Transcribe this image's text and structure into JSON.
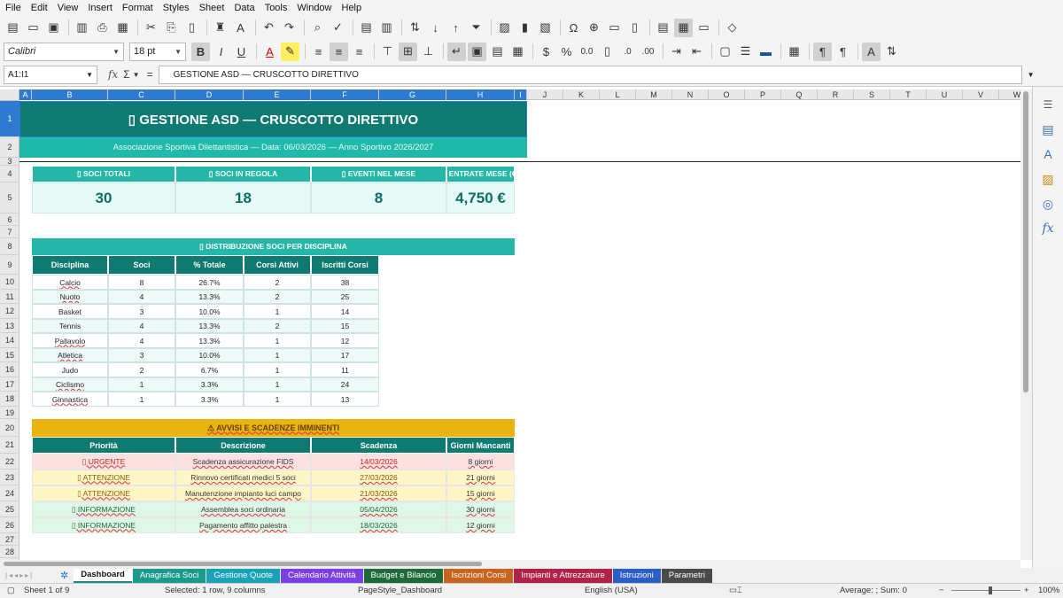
{
  "menu": [
    "File",
    "Edit",
    "View",
    "Insert",
    "Format",
    "Styles",
    "Sheet",
    "Data",
    "Tools",
    "Window",
    "Help"
  ],
  "font": {
    "name": "Calibri",
    "size": "18 pt"
  },
  "formula": {
    "namebox": "A1:I1",
    "content": " GESTIONE ASD — CRUSCOTTO DIRETTIVO",
    "fx": "fx",
    "sigma": "Σ",
    "equals": "="
  },
  "columns": [
    "A",
    "B",
    "C",
    "D",
    "E",
    "F",
    "G",
    "H",
    "I",
    "J",
    "K",
    "L",
    "M",
    "N",
    "O",
    "P",
    "Q",
    "R",
    "S",
    "T",
    "U",
    "V",
    "W"
  ],
  "rows": [
    "1",
    "2",
    "3",
    "4",
    "5",
    "6",
    "7",
    "8",
    "9",
    "10",
    "11",
    "12",
    "13",
    "14",
    "15",
    "16",
    "17",
    "18",
    "19",
    "20",
    "21",
    "22",
    "23",
    "24",
    "25",
    "26",
    "27",
    "28"
  ],
  "sheet": {
    "title": "▯  GESTIONE ASD — CRUSCOTTO DIRETTIVO",
    "subtitle": "Associazione Sportiva Dilettantistica  —  Data: 06/03/2026  —  Anno Sportivo 2026/2027",
    "kpis": [
      {
        "label": "▯ SOCI TOTALI",
        "value": "30"
      },
      {
        "label": "▯ SOCI IN REGOLA",
        "value": "18"
      },
      {
        "label": "▯ EVENTI NEL MESE",
        "value": "8"
      },
      {
        "label": "▯ ENTRATE MESE (€)",
        "value": "4,750 €"
      }
    ],
    "discipline_title": "▯ DISTRIBUZIONE SOCI PER DISCIPLINA",
    "discipline_headers": [
      "Disciplina",
      "Soci",
      "% Totale",
      "Corsi Attivi",
      "Iscritti Corsi"
    ],
    "discipline_rows": [
      [
        "Calcio",
        "8",
        "26.7%",
        "2",
        "38"
      ],
      [
        "Nuoto",
        "4",
        "13.3%",
        "2",
        "25"
      ],
      [
        "Basket",
        "3",
        "10.0%",
        "1",
        "14"
      ],
      [
        "Tennis",
        "4",
        "13.3%",
        "2",
        "15"
      ],
      [
        "Pallavolo",
        "4",
        "13.3%",
        "1",
        "12"
      ],
      [
        "Atletica",
        "3",
        "10.0%",
        "1",
        "17"
      ],
      [
        "Judo",
        "2",
        "6.7%",
        "1",
        "11"
      ],
      [
        "Ciclismo",
        "1",
        "3.3%",
        "1",
        "24"
      ],
      [
        "Ginnastica",
        "1",
        "3.3%",
        "1",
        "13"
      ]
    ],
    "alerts_title": "⚠ AVVISI E SCADENZE IMMINENTI",
    "alerts_headers": [
      "Priorità",
      "Descrizione",
      "Scadenza",
      "Giorni Mancanti"
    ],
    "alerts_rows": [
      {
        "level": "urgent",
        "cells": [
          "▯ URGENTE",
          "Scadenza assicurazione FIDS",
          "14/03/2026",
          "8 giorni"
        ]
      },
      {
        "level": "warn",
        "cells": [
          "▯ ATTENZIONE",
          "Rinnovo certificati medici 5 soci",
          "27/03/2026",
          "21 giorni"
        ]
      },
      {
        "level": "warn",
        "cells": [
          "▯ ATTENZIONE",
          "Manutenzione impianto luci campo",
          "21/03/2026",
          "15 giorni"
        ]
      },
      {
        "level": "info",
        "cells": [
          "▯ INFORMAZIONE",
          "Assemblea soci ordinaria",
          "05/04/2026",
          "30 giorni"
        ]
      },
      {
        "level": "info",
        "cells": [
          "▯ INFORMAZIONE",
          "Pagamento affitto palestra",
          "18/03/2026",
          "12 giorni"
        ]
      }
    ]
  },
  "tabs": [
    {
      "label": "Dashboard",
      "color": "#ffffff",
      "active": true
    },
    {
      "label": "Anagrafica Soci",
      "color": "#1a9a8a"
    },
    {
      "label": "Gestione Quote",
      "color": "#17a2b8"
    },
    {
      "label": "Calendario Attività",
      "color": "#7b3fe4"
    },
    {
      "label": "Budget e Bilancio",
      "color": "#1e6b3a"
    },
    {
      "label": "Iscrizioni Corsi",
      "color": "#c8641e"
    },
    {
      "label": "Impianti e Attrezzature",
      "color": "#b0224a"
    },
    {
      "label": "Istruzioni",
      "color": "#2a5fc8"
    },
    {
      "label": "Parametri",
      "color": "#4a4a4a"
    }
  ],
  "status": {
    "sheet": "Sheet 1 of 9",
    "selection": "Selected: 1 row, 9 columns",
    "pagestyle": "PageStyle_Dashboard",
    "language": "English (USA)",
    "sum": "Average: ; Sum: 0",
    "zoom": "100%"
  },
  "colors": {
    "title_bg": "#0f7a72",
    "subtitle_bg": "#20b8a8",
    "kpi_header_bg": "#24b6a6",
    "kpi_value_bg": "#e6faf8",
    "kpi_value_text": "#0d6e66",
    "table_header_bg": "#0f7a72",
    "alert_title_bg": "#e9b40e",
    "urgent_bg": "#fde1e1",
    "warn_bg": "#fff6c8",
    "info_bg": "#dff7e6"
  }
}
